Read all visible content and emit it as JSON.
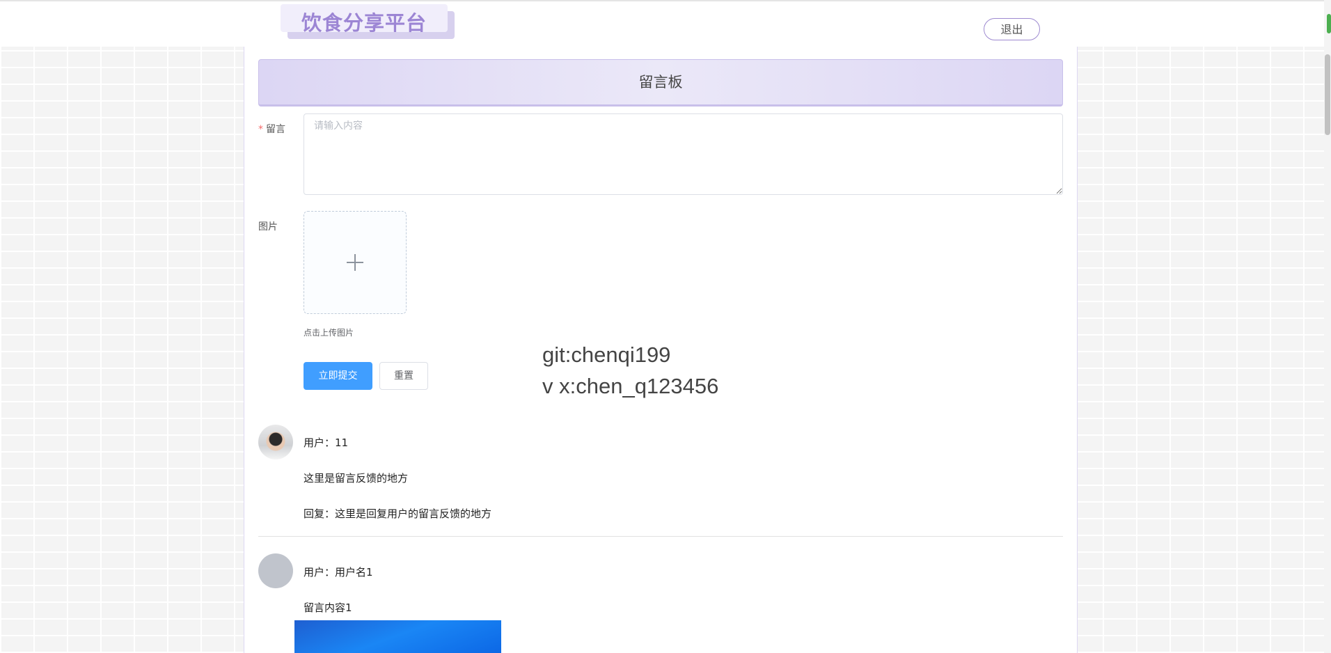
{
  "header": {
    "logo_text": "饮食分享平台",
    "logout_label": "退出"
  },
  "board": {
    "title": "留言板"
  },
  "form": {
    "message_label": "留言",
    "required_mark": "*",
    "message_placeholder": "请输入内容",
    "image_label": "图片",
    "upload_tip": "点击上传图片",
    "submit_label": "立即提交",
    "reset_label": "重置"
  },
  "watermark": {
    "line1": "git:chenqi199",
    "line2": "v x:chen_q123456"
  },
  "comments": [
    {
      "user": "用户：11",
      "content": "这里是留言反馈的地方",
      "reply": "回复：这里是回复用户的留言反馈的地方"
    },
    {
      "user": "用户：用户名1",
      "content": "留言内容1"
    }
  ],
  "colors": {
    "accent": "#409eff",
    "brand": "#9c85d4",
    "header_bg": "#dcd6f4"
  }
}
